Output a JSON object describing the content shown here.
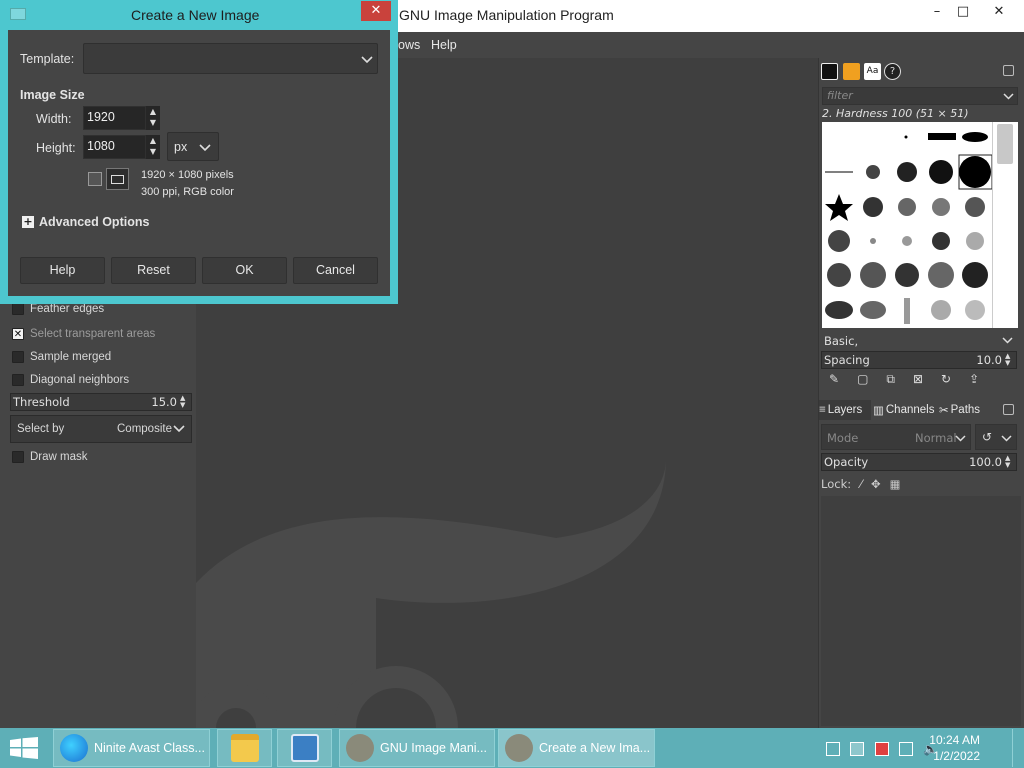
{
  "main_window": {
    "title": "GNU Image Manipulation Program",
    "controls": {
      "minimize": "–",
      "maximize": "□",
      "close": "✕"
    },
    "menu": [
      "ows",
      "Help"
    ]
  },
  "tool_options": {
    "feather_edges": "Feather edges",
    "select_transparent": "Select transparent areas",
    "sample_merged": "Sample merged",
    "diagonal_neighbors": "Diagonal neighbors",
    "threshold_label": "Threshold",
    "threshold_value": "15.0",
    "select_by_label": "Select by",
    "select_by_value": "Composite",
    "draw_mask": "Draw mask"
  },
  "dock": {
    "filter_placeholder": "filter",
    "brush_name": "2. Hardness 100 (51 × 51)",
    "brush_set": "Basic,",
    "spacing_label": "Spacing",
    "spacing_value": "10.0",
    "tabs": [
      "Layers",
      "Channels",
      "Paths"
    ],
    "mode_label": "Mode",
    "mode_value": "Normal",
    "opacity_label": "Opacity",
    "opacity_value": "100.0",
    "lock_label": "Lock:"
  },
  "dialog": {
    "title": "Create a New Image",
    "close": "✕",
    "template_label": "Template:",
    "template_value": "",
    "image_size_heading": "Image Size",
    "width_label": "Width:",
    "width_value": "1920",
    "height_label": "Height:",
    "height_value": "1080",
    "unit": "px",
    "info_line1": "1920 × 1080 pixels",
    "info_line2": "300 ppi, RGB color",
    "advanced": "Advanced Options",
    "buttons": {
      "help": "Help",
      "reset": "Reset",
      "ok": "OK",
      "cancel": "Cancel"
    }
  },
  "taskbar": {
    "items": [
      "Ninite Avast Class...",
      "GNU Image Mani...",
      "Create a New Ima..."
    ],
    "time": "10:24 AM",
    "date": "1/2/2022"
  },
  "colors": {
    "dialog_frame": "#4dc7cf",
    "taskbar": "#5eafb7",
    "close_red": "#c9423c"
  }
}
